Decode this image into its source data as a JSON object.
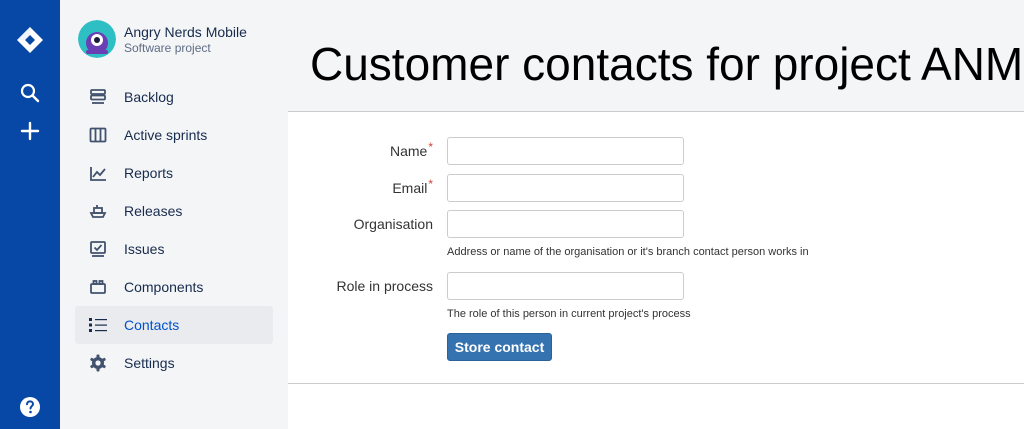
{
  "project": {
    "name": "Angry Nerds Mobile",
    "type": "Software project"
  },
  "sidebar": {
    "items": [
      {
        "label": "Backlog",
        "icon": "backlog-icon"
      },
      {
        "label": "Active sprints",
        "icon": "board-icon"
      },
      {
        "label": "Reports",
        "icon": "reports-icon"
      },
      {
        "label": "Releases",
        "icon": "ship-icon"
      },
      {
        "label": "Issues",
        "icon": "issues-icon"
      },
      {
        "label": "Components",
        "icon": "components-icon"
      },
      {
        "label": "Contacts",
        "icon": "list-icon",
        "active": true
      },
      {
        "label": "Settings",
        "icon": "gear-icon"
      }
    ]
  },
  "page": {
    "title": "Customer contacts for project ANM"
  },
  "form": {
    "name_label": "Name",
    "email_label": "Email",
    "required_marker": "*",
    "organisation_label": "Organisation",
    "organisation_help": "Address or name of the organisation or it's branch contact person works in",
    "role_label": "Role in process",
    "role_help": "The role of this person in current project's process",
    "name_value": "",
    "email_value": "",
    "organisation_value": "",
    "role_value": "",
    "submit_label": "Store contact"
  },
  "colors": {
    "rail": "#0747a6",
    "sidebar_bg": "#f4f5f7",
    "active_link": "#0052cc",
    "button": "#3572b0",
    "required": "#d04437"
  }
}
